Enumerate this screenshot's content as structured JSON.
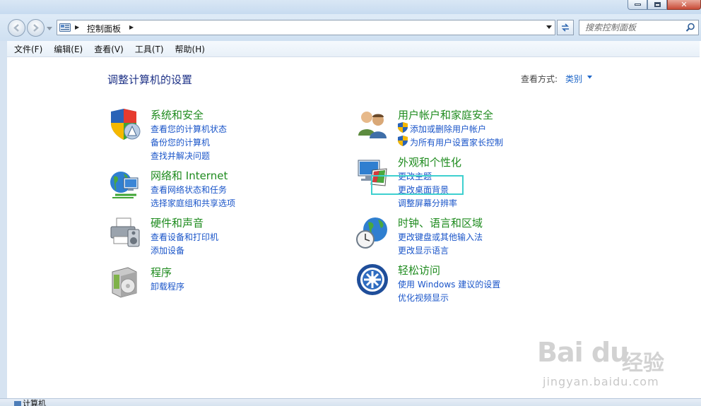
{
  "window": {
    "address_path": "控制面板",
    "search_placeholder": "搜索控制面板"
  },
  "menu": [
    "文件(F)",
    "编辑(E)",
    "查看(V)",
    "工具(T)",
    "帮助(H)"
  ],
  "page_title": "调整计算机的设置",
  "view_by": {
    "label": "查看方式:",
    "value": "类别"
  },
  "categories": [
    {
      "title": "系统和安全",
      "icon": "shield-icon",
      "links": [
        "查看您的计算机状态",
        "备份您的计算机",
        "查找并解决问题"
      ]
    },
    {
      "title": "网络和 Internet",
      "icon": "network-globe-icon",
      "links": [
        "查看网络状态和任务",
        "选择家庭组和共享选项"
      ]
    },
    {
      "title": "硬件和声音",
      "icon": "printer-icon",
      "links": [
        "查看设备和打印机",
        "添加设备"
      ]
    },
    {
      "title": "程序",
      "icon": "programs-box-icon",
      "links": [
        "卸载程序"
      ]
    },
    {
      "title": "用户帐户和家庭安全",
      "icon": "users-icon",
      "links": [
        "添加或删除用户帐户",
        "为所有用户设置家长控制"
      ]
    },
    {
      "title": "外观和个性化",
      "icon": "monitor-appearance-icon",
      "links": [
        "更改主题",
        "更改桌面背景",
        "调整屏幕分辨率"
      ]
    },
    {
      "title": "时钟、语言和区域",
      "icon": "clock-globe-icon",
      "links": [
        "更改键盘或其他输入法",
        "更改显示语言"
      ]
    },
    {
      "title": "轻松访问",
      "icon": "ease-of-access-icon",
      "links": [
        "使用 Windows 建议的设置",
        "优化视频显示"
      ]
    }
  ],
  "status": {
    "text": "计算机"
  },
  "watermark": {
    "logo": "Bai du",
    "brand": "经验",
    "url": "jingyan.baidu.com"
  },
  "colors": {
    "title_blue": "#1e3287",
    "category_green": "#1e8b1e",
    "link_blue": "#1a55c9",
    "highlight": "#3ed0cf"
  }
}
